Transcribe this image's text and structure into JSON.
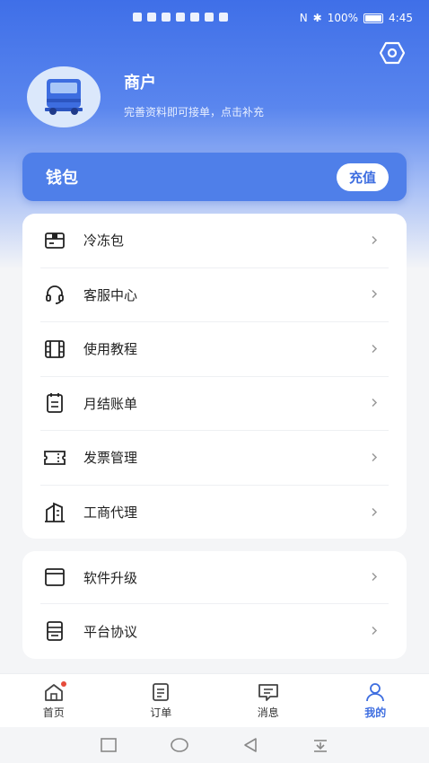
{
  "status_bar": {
    "battery": "100%",
    "time": "4:45"
  },
  "header": {
    "name": "商户",
    "subtitle": "完善资料即可接单，点击补充"
  },
  "wallet": {
    "title": "钱包",
    "recharge_label": "充值"
  },
  "menu_main": [
    {
      "label": "冷冻包",
      "icon": "box-icon"
    },
    {
      "label": "客服中心",
      "icon": "headset-icon"
    },
    {
      "label": "使用教程",
      "icon": "film-icon"
    },
    {
      "label": "月结账单",
      "icon": "bill-icon"
    },
    {
      "label": "发票管理",
      "icon": "ticket-icon"
    },
    {
      "label": "工商代理",
      "icon": "building-icon"
    }
  ],
  "menu_secondary": [
    {
      "label": "软件升级",
      "icon": "window-icon"
    },
    {
      "label": "平台协议",
      "icon": "document-icon"
    }
  ],
  "tabs": [
    {
      "label": "首页",
      "icon": "home-icon",
      "active": false,
      "badge": true
    },
    {
      "label": "订单",
      "icon": "order-icon",
      "active": false
    },
    {
      "label": "消息",
      "icon": "message-icon",
      "active": false
    },
    {
      "label": "我的",
      "icon": "user-icon",
      "active": true
    }
  ],
  "colors": {
    "accent": "#3d6de0",
    "badge": "#e64b3b"
  }
}
